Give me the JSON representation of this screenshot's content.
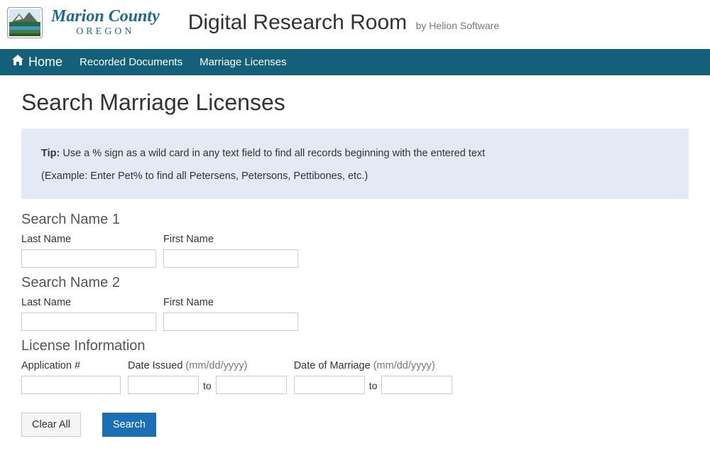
{
  "header": {
    "county_name": "Marion County",
    "county_sub": "OREGON",
    "app_title": "Digital Research Room",
    "byline": "by Helion Software"
  },
  "nav": {
    "home": "Home",
    "recorded_documents": "Recorded Documents",
    "marriage_licenses": "Marriage Licenses"
  },
  "page": {
    "title": "Search Marriage Licenses"
  },
  "tip": {
    "label": "Tip:",
    "text": "Use a % sign as a wild card in any text field to find all records beginning with the entered text",
    "example": "(Example: Enter Pet% to find all Petersens, Petersons, Pettibones, etc.)"
  },
  "sections": {
    "name1": "Search Name 1",
    "name2": "Search Name 2",
    "license": "License Information"
  },
  "labels": {
    "last_name": "Last Name",
    "first_name": "First Name",
    "application_num": "Application #",
    "date_issued": "Date Issued",
    "date_issued_hint": "(mm/dd/yyyy)",
    "date_marriage": "Date of Marriage",
    "date_marriage_hint": "(mm/dd/yyyy)",
    "to": "to"
  },
  "buttons": {
    "clear_all": "Clear All",
    "search": "Search"
  }
}
